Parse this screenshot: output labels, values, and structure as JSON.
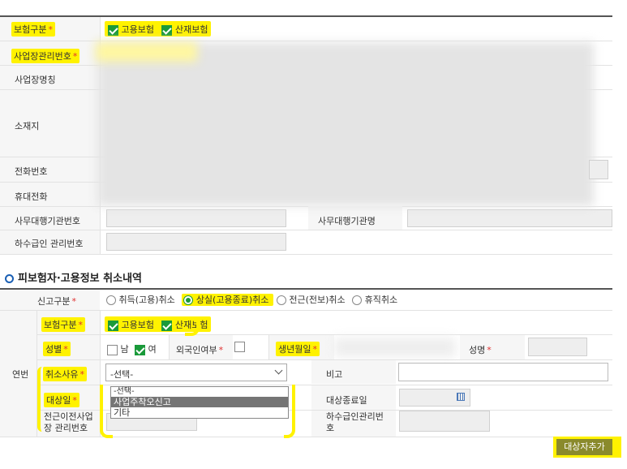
{
  "top_section": {
    "insurance_type": {
      "label": "보험구분",
      "required_mark": "*",
      "options": [
        {
          "label": "고용보험",
          "checked": true
        },
        {
          "label": "산재보험",
          "checked": true
        }
      ]
    },
    "business_no": {
      "label": "사업장관리번호",
      "required_mark": "*"
    },
    "business_name": {
      "label": "사업장명칭"
    },
    "address": {
      "label": "소재지"
    },
    "phone": {
      "label": "전화번호"
    },
    "mobile": {
      "label": "휴대전화"
    },
    "agency_no": {
      "label": "사무대행기관번호"
    },
    "agency_name": {
      "label": "사무대행기관명"
    },
    "subcontractor_no": {
      "label": "하수급인 관리번호"
    }
  },
  "section": {
    "title": "피보험자·고용정보 취소내역"
  },
  "report_type": {
    "label": "신고구분",
    "required_mark": "*",
    "options": [
      {
        "label": "취득(고용)취소",
        "selected": false
      },
      {
        "label": "상실(고용종료)취소",
        "selected": true
      },
      {
        "label": "전근(전보)취소",
        "selected": false
      },
      {
        "label": "휴직취소",
        "selected": false
      }
    ]
  },
  "detail": {
    "row_label": "연번",
    "insurance_type": {
      "label": "보험구분",
      "required_mark": "*",
      "options": [
        {
          "label": "고용보험",
          "checked": true
        },
        {
          "label": "산재보험",
          "checked": true
        }
      ]
    },
    "gender": {
      "label": "성별",
      "required_mark": "*",
      "options": [
        {
          "label": "남",
          "checked": false
        },
        {
          "label": "여",
          "checked": true
        }
      ]
    },
    "foreigner": {
      "label": "외국인여부",
      "required_mark": "*",
      "checked": false
    },
    "birth": {
      "label": "생년월일",
      "required_mark": "*"
    },
    "name": {
      "label": "성명",
      "required_mark": "*"
    },
    "cancel_reason": {
      "label": "취소사유",
      "required_mark": "*",
      "value": "-선택-",
      "options": [
        "-선택-",
        "사업주착오신고",
        "기타"
      ],
      "highlighted_index": 1
    },
    "note": {
      "label": "비고"
    },
    "target_date": {
      "label": "대상일",
      "required_mark": "*"
    },
    "end_date": {
      "label": "대상종료일"
    },
    "prev_business_no": {
      "label": "전근이전사업장 관리번호"
    },
    "sub_no": {
      "label": "하수급인관리번호"
    }
  },
  "add_button": {
    "label": "대상자추가"
  },
  "colors": {
    "accent": "#1a9a3a",
    "highlight": "#fff200",
    "label_bg": "#f6f6f6",
    "button_bg": "#8a8a2c"
  }
}
